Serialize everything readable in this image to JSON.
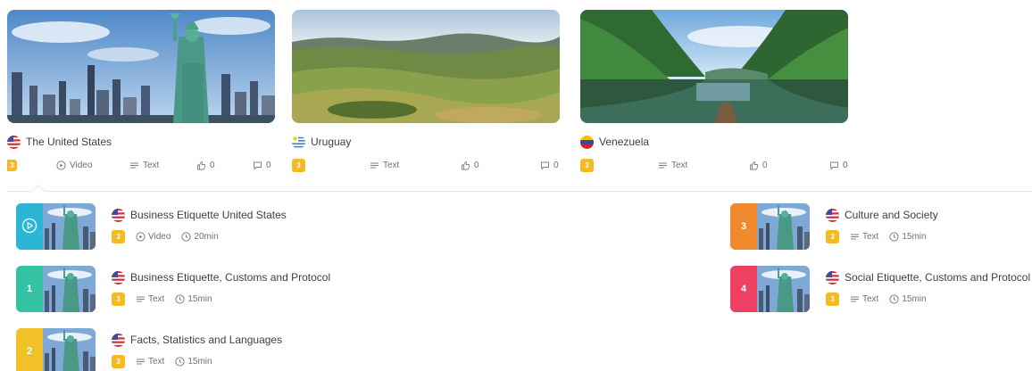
{
  "cards": [
    {
      "name": "The United States",
      "level": "3",
      "video_label": "Video",
      "text_label": "Text",
      "likes": "0",
      "comments": "0"
    },
    {
      "name": "Uruguay",
      "level": "3",
      "text_label": "Text",
      "likes": "0",
      "comments": "0"
    },
    {
      "name": "Venezuela",
      "level": "3",
      "text_label": "Text",
      "likes": "0",
      "comments": "0"
    }
  ],
  "lessons": [
    {
      "title": "Business Etiquette United States",
      "number": "",
      "level": "3",
      "type": "Video",
      "duration": "20min",
      "accent": "#2bb6d6"
    },
    {
      "title": "Business Etiquette, Customs and Protocol",
      "number": "1",
      "level": "3",
      "type": "Text",
      "duration": "15min",
      "accent": "#35c2a2"
    },
    {
      "title": "Facts, Statistics and Languages",
      "number": "2",
      "level": "3",
      "type": "Text",
      "duration": "15min",
      "accent": "#f0c227"
    },
    {
      "title": "Culture and Society",
      "number": "3",
      "level": "3",
      "type": "Text",
      "duration": "15min",
      "accent": "#f08a2c"
    },
    {
      "title": "Social Etiquette, Customs and Protocol",
      "number": "4",
      "level": "3",
      "type": "Text",
      "duration": "15min",
      "accent": "#ef3f63"
    }
  ]
}
